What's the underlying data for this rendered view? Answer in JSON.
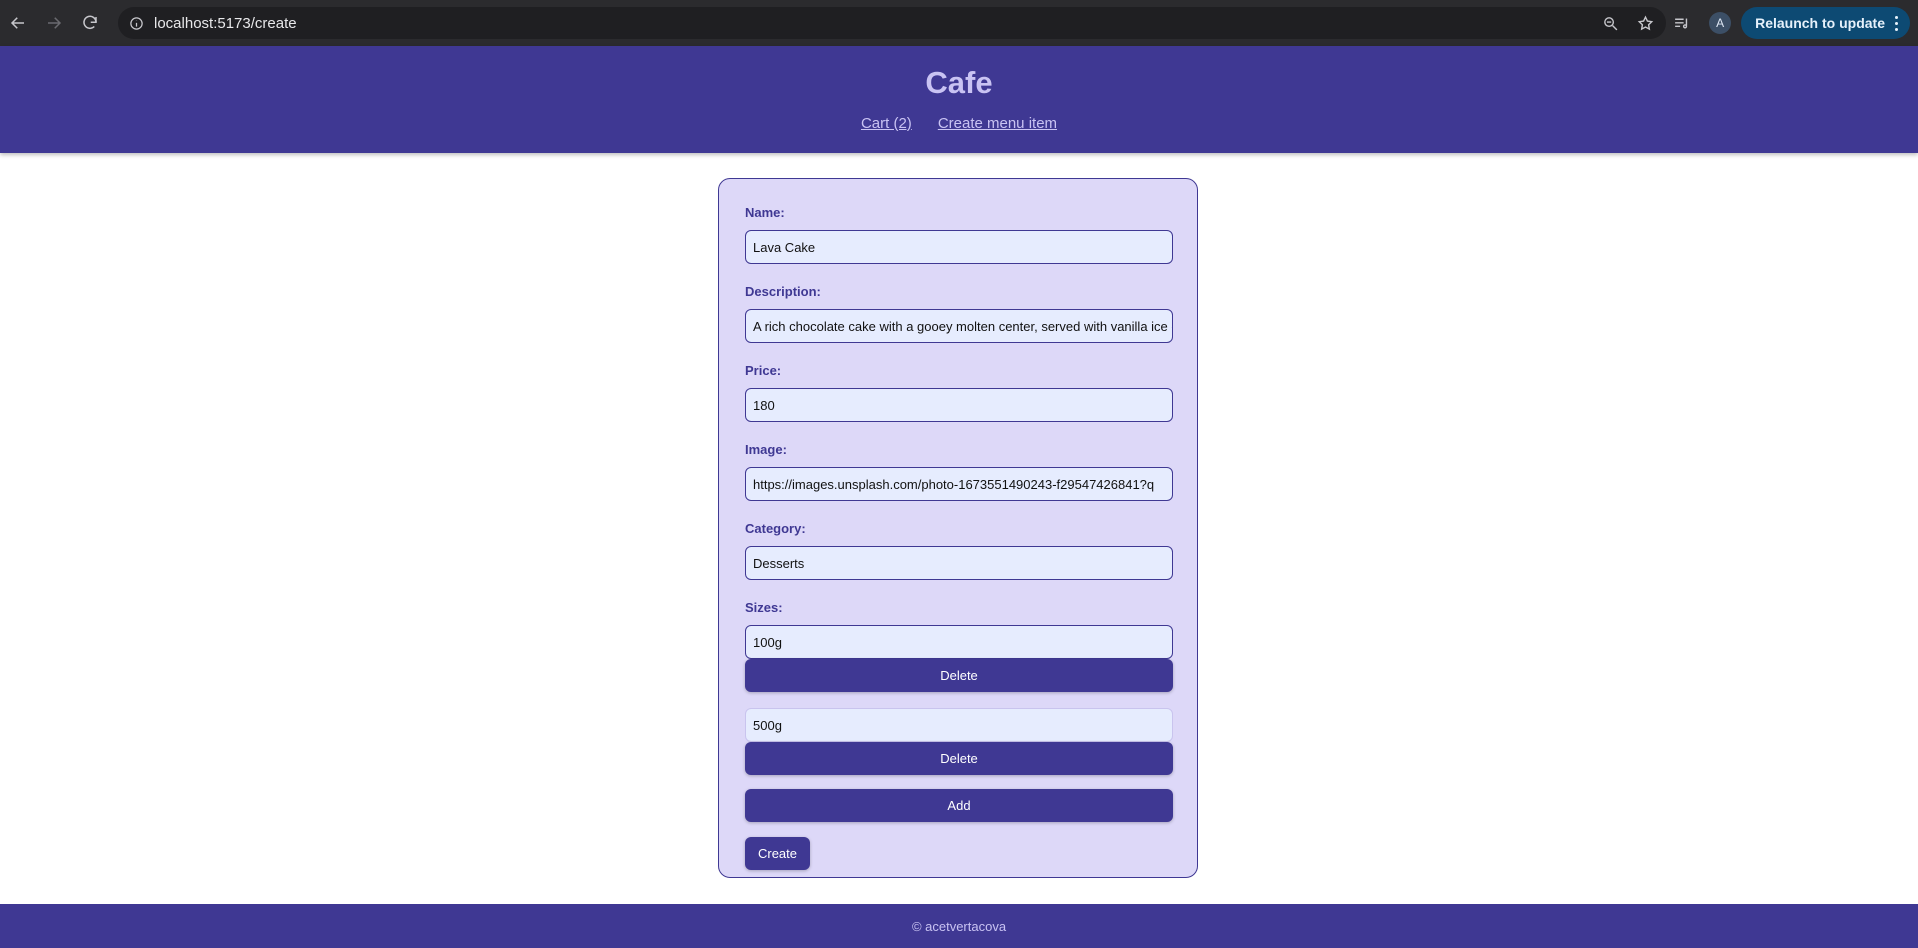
{
  "browser": {
    "url": "localhost:5173/create",
    "relaunch_label": "Relaunch to update",
    "profile_initial": "A"
  },
  "app": {
    "title": "Cafe",
    "nav": {
      "cart": "Cart (2)",
      "create": "Create menu item"
    }
  },
  "form": {
    "name_label": "Name:",
    "name_value": "Lava Cake",
    "description_label": "Description:",
    "description_value": "A rich chocolate cake with a gooey molten center, served with vanilla ice cream",
    "price_label": "Price:",
    "price_value": "180",
    "image_label": "Image:",
    "image_value": "https://images.unsplash.com/photo-1673551490243-f29547426841?q",
    "category_label": "Category:",
    "category_value": "Desserts",
    "sizes_label": "Sizes:",
    "sizes": [
      {
        "value": "100g",
        "delete_label": "Delete"
      },
      {
        "value": "500g",
        "delete_label": "Delete"
      }
    ],
    "add_label": "Add",
    "create_label": "Create"
  },
  "footer": {
    "text": "© acetvertacova"
  },
  "colors": {
    "brand": "#3f3893",
    "card_bg": "#ddd8f8",
    "input_bg": "#e6ecfe",
    "header_text": "#c9c3f3"
  }
}
